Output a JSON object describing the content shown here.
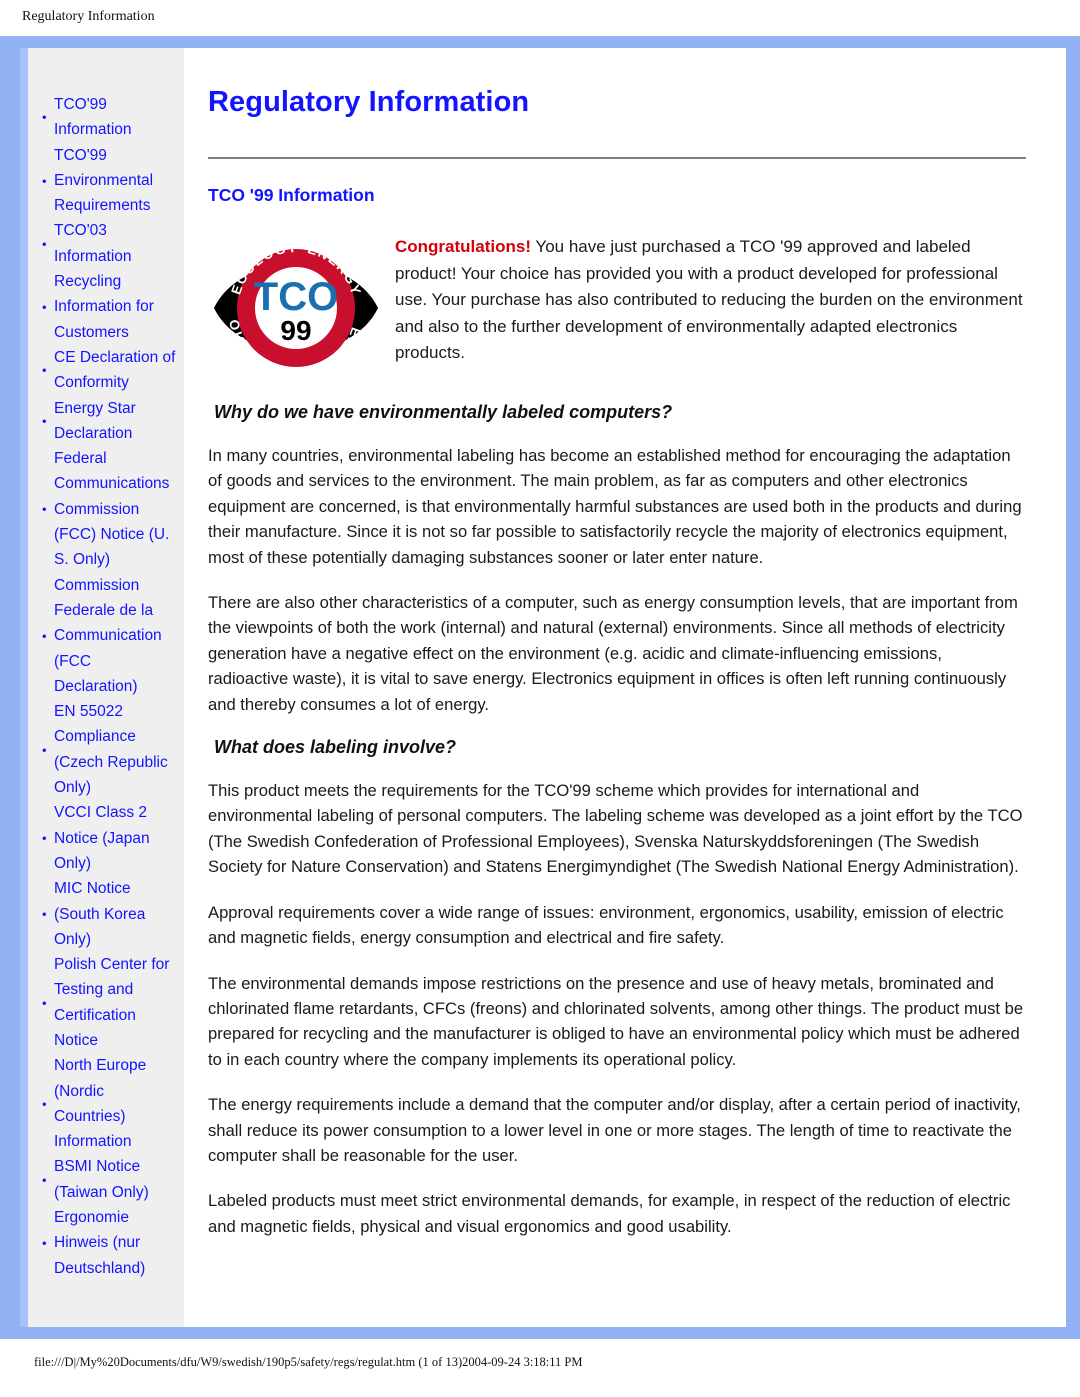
{
  "header": {
    "title": "Regulatory Information"
  },
  "sidebar": {
    "items": [
      {
        "label": "TCO'99 Information"
      },
      {
        "label": "TCO'99 Environmental Requirements"
      },
      {
        "label": "TCO'03 Information"
      },
      {
        "label": "Recycling Information for Customers"
      },
      {
        "label": "CE Declaration of Conformity"
      },
      {
        "label": "Energy Star Declaration"
      },
      {
        "label": "Federal Communications Commission (FCC) Notice (U. S. Only)"
      },
      {
        "label": "Commission Federale de la Communication (FCC Declaration)"
      },
      {
        "label": "EN 55022 Compliance (Czech Republic Only)"
      },
      {
        "label": "VCCI Class 2 Notice (Japan Only)"
      },
      {
        "label": "MIC Notice (South Korea Only)"
      },
      {
        "label": "Polish Center for Testing and Certification Notice"
      },
      {
        "label": "North Europe (Nordic Countries) Information"
      },
      {
        "label": "BSMI Notice (Taiwan Only)"
      },
      {
        "label": "Ergonomie Hinweis (nur Deutschland)"
      }
    ]
  },
  "main": {
    "page_title": "Regulatory Information",
    "section_title": "TCO '99 Information",
    "logo": {
      "name": "tco-99-certification-logo",
      "center_text": "TCO",
      "year_text": "99",
      "ring_words": [
        "ECOLOGY",
        "ENERGY",
        "EMISSIONS",
        "ERGONOMICS"
      ],
      "ring_color": "#c8102e",
      "wordmark_color": "#1a6faf",
      "year_color": "#000000"
    },
    "intro": {
      "lead": "Congratulations!",
      "text": " You have just purchased a TCO '99 approved and labeled product! Your choice has provided you with a product developed for professional use. Your purchase has also contributed to reducing the burden on the environment and also to the further development of environmentally adapted electronics products."
    },
    "subhead_1": "Why do we have environmentally labeled computers?",
    "paragraph_1": "In many countries, environmental labeling has become an established method for encouraging the adaptation of goods and services to the environment. The main problem, as far as computers and other electronics equipment are concerned, is that environmentally harmful substances are used both in the products and during their manufacture. Since it is not so far possible to satisfactorily recycle the majority of electronics equipment, most of these potentially damaging substances sooner or later enter nature.",
    "paragraph_2": "There are also other characteristics of a computer, such as energy consumption levels, that are important from the viewpoints of both the work (internal) and natural (external) environments. Since all methods of electricity generation have a negative effect on the environment (e.g. acidic and climate-influencing emissions, radioactive waste), it is vital to save energy. Electronics equipment in offices is often left running continuously and thereby consumes a lot of energy.",
    "subhead_2": "What does labeling involve?",
    "paragraph_3": "This product meets the requirements for the TCO'99 scheme which provides for international and environmental labeling of personal computers. The labeling scheme was developed as a joint effort by the TCO (The Swedish Confederation of Professional Employees), Svenska Naturskyddsforeningen (The Swedish Society for Nature Conservation) and Statens Energimyndighet (The Swedish National Energy Administration).",
    "paragraph_4": "Approval requirements cover a wide range of issues: environment, ergonomics, usability, emission of electric and magnetic fields, energy consumption and electrical and fire safety.",
    "paragraph_5": "The environmental demands impose restrictions on the presence and use of heavy metals, brominated and chlorinated flame retardants, CFCs (freons) and chlorinated solvents, among other things. The product must be prepared for recycling and the manufacturer is obliged to have an environmental policy which must be adhered to in each country where the company implements its operational policy.",
    "paragraph_6": "The energy requirements include a demand that the computer and/or display, after a certain period of inactivity, shall reduce its power consumption to a lower level in one or more stages. The length of time to reactivate the computer shall be reasonable for the user.",
    "paragraph_7": "Labeled products must meet strict environmental demands, for example, in respect of the reduction of electric and magnetic fields, physical and visual ergonomics and good usability."
  },
  "footer": {
    "path": "file:///D|/My%20Documents/dfu/W9/swedish/190p5/safety/regs/regulat.htm (1 of 13)2004-09-24 3:18:11 PM"
  },
  "colors": {
    "link_blue": "#1414ff",
    "frame_blue": "#93b1f5",
    "sidebar_gray": "#efefef",
    "accent_red": "#d4000b"
  }
}
